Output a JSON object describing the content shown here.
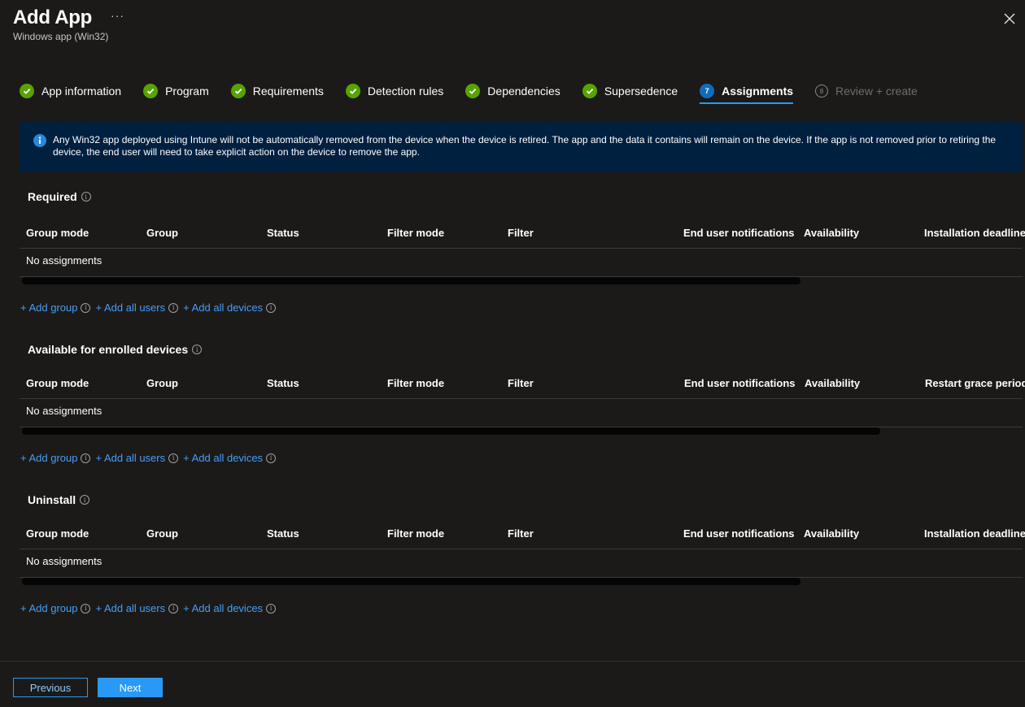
{
  "header": {
    "title": "Add App",
    "more": "···",
    "subtitle": "Windows app (Win32)"
  },
  "steps": [
    {
      "label": "App information",
      "state": "done"
    },
    {
      "label": "Program",
      "state": "done"
    },
    {
      "label": "Requirements",
      "state": "done"
    },
    {
      "label": "Detection rules",
      "state": "done"
    },
    {
      "label": "Dependencies",
      "state": "done"
    },
    {
      "label": "Supersedence",
      "state": "done"
    },
    {
      "label": "Assignments",
      "number": "7",
      "state": "current"
    },
    {
      "label": "Review + create",
      "number": "8",
      "state": "todo"
    }
  ],
  "banner": {
    "text": "Any Win32 app deployed using Intune will not be automatically removed from the device when the device is retired. The app and the data it contains will remain on the device. If the app is not removed prior to retiring the device, the end user will need to take explicit action on the device to remove the app."
  },
  "sections": {
    "required": {
      "title": "Required",
      "columns": [
        "Group mode",
        "Group",
        "Status",
        "Filter mode",
        "Filter",
        "End user notifications",
        "Availability",
        "Installation deadline"
      ],
      "empty": "No assignments"
    },
    "available": {
      "title": "Available for enrolled devices",
      "columns": [
        "Group mode",
        "Group",
        "Status",
        "Filter mode",
        "Filter",
        "End user notifications",
        "Availability",
        "Restart grace period"
      ],
      "empty": "No assignments"
    },
    "uninstall": {
      "title": "Uninstall",
      "columns": [
        "Group mode",
        "Group",
        "Status",
        "Filter mode",
        "Filter",
        "End user notifications",
        "Availability",
        "Installation deadline"
      ],
      "empty": "No assignments"
    }
  },
  "links": {
    "add_group": "+ Add group",
    "add_all_users": "+ Add all users",
    "add_all_devices": "+ Add all devices"
  },
  "footer": {
    "previous": "Previous",
    "next": "Next"
  },
  "colors": {
    "background": "#1b1a19",
    "accent": "#2899f5",
    "success": "#57a300",
    "banner": "#002040",
    "link": "#479ef5"
  }
}
